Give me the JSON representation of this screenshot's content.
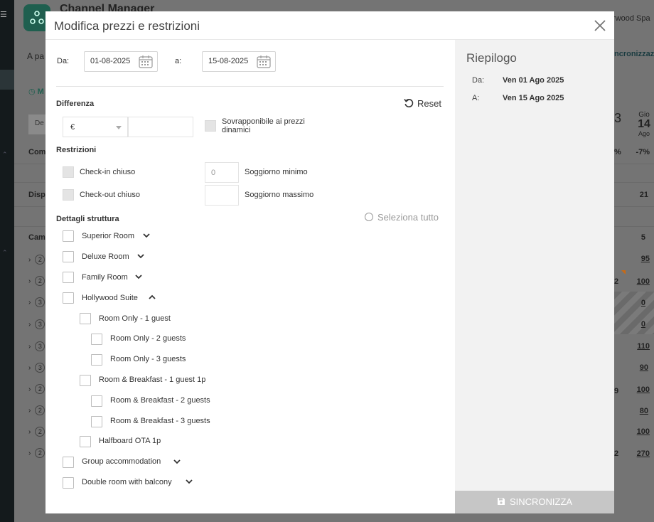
{
  "background": {
    "app_title": "Channel Manager",
    "hotel_name": "rwood Spa",
    "subtitle": "A pa",
    "sync_link": "ncronizzaz",
    "mode_label": "M",
    "filter_label": "De",
    "rows": [
      {
        "label": "Com",
        "values": [
          "%",
          "-7%"
        ]
      },
      {
        "label": "Disp",
        "values": [
          "21"
        ]
      },
      {
        "label": "Cam",
        "values": [
          "5"
        ]
      }
    ],
    "date_header": {
      "dow": "Gio",
      "day": "14",
      "month": "Ago",
      "prev_day_fragment": "3"
    },
    "expander_counts": [
      "2",
      "2",
      "3",
      "3",
      "3",
      "3",
      "2",
      "2",
      "2",
      "2"
    ],
    "prices": [
      "95",
      "100",
      "0",
      "0",
      "110",
      "90",
      "100",
      "80",
      "100",
      "270"
    ],
    "side_fragments": [
      "2",
      "9",
      "2"
    ]
  },
  "modal": {
    "title": "Modifica prezzi e restrizioni",
    "date_from_label": "Da:",
    "date_from_value": "01-08-2025",
    "date_to_label": "a:",
    "date_to_value": "15-08-2025",
    "difference_title": "Differenza",
    "reset_label": "Reset",
    "currency_value": "€",
    "amount_value": "",
    "overlap_label": "Sovrapponibile ai prezzi dinamici",
    "restrictions_title": "Restrizioni",
    "checkin_closed": "Check-in chiuso",
    "checkout_closed": "Check-out chiuso",
    "min_stay_placeholder": "0",
    "min_stay_label": "Soggiorno minimo",
    "max_stay_label": "Soggiorno massimo",
    "structure_title": "Dettagli struttura",
    "select_all_label": "Seleziona tutto",
    "rooms": [
      "Superior Room",
      "Deluxe Room",
      "Family Room",
      "Hollywood Suite",
      "Room Only - 1 guest",
      "Room Only - 2 guests",
      "Room Only - 3 guests",
      "Room & Breakfast - 1 guest 1p",
      "Room & Breakfast - 2 guests",
      "Room & Breakfast - 3 guests",
      "Halfboard OTA 1p",
      "Group accommodation",
      "Double room with balcony"
    ]
  },
  "summary": {
    "title": "Riepilogo",
    "from_label": "Da:",
    "from_value": "Ven 01 Ago 2025",
    "to_label": "A:",
    "to_value": "Ven 15 Ago 2025",
    "sync_button": "SINCRONIZZA"
  },
  "icons": [
    "menu-icon",
    "app-logo-icon",
    "close-icon",
    "calendar-icon",
    "reset-icon",
    "chevron-down-icon",
    "chevron-up-icon",
    "radio-icon",
    "save-icon"
  ]
}
